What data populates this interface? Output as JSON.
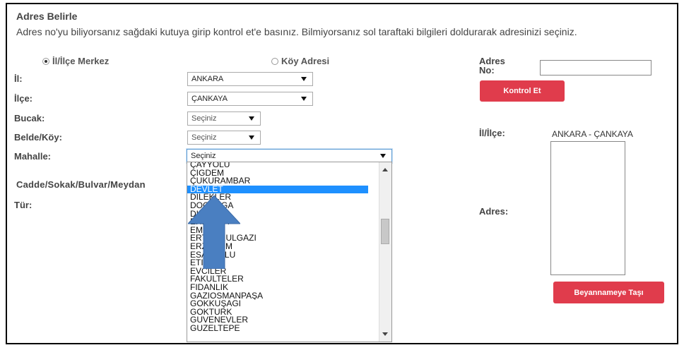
{
  "form": {
    "title": "Adres Belirle",
    "intro": "Adres no'yu biliyorsanız sağdaki kutuya girip kontrol et'e basınız. Bilmiyorsanız sol taraftaki bilgileri doldurarak adresinizi seçiniz.",
    "radio_merkez": "İl/İlçe Merkez",
    "radio_koy": "Köy Adresi",
    "radio_selected": "İl/İlçe Merkez"
  },
  "fields": {
    "il_label": "İl:",
    "il_value": "ANKARA",
    "ilce_label": "İlçe:",
    "ilce_value": "ÇANKAYA",
    "bucak_label": "Bucak:",
    "bucak_value": "Seçiniz",
    "belde_label": "Belde/Köy:",
    "belde_value": "Seçiniz",
    "mahalle_label": "Mahalle:",
    "mahalle_value": "Seçiniz",
    "cadde_label": "Cadde/Sokak/Bulvar/Meydan",
    "tur_label": "Tür:"
  },
  "dropdown": {
    "options": [
      "ÇAYYOLU",
      "ÇİĞDEM",
      "ÇUKURAMBAR",
      "DEVLET",
      "DİLEKLER",
      "DOĞANGA",
      "DİKMEN",
      "EHLİBEYT",
      "EMEK",
      "ERTUĞRULGAZİ",
      "ERZURUM",
      "ESATOĞLU",
      "ETİ",
      "EVCİLER",
      "FAKÜLTELER",
      "FİDANLIK",
      "GAZİOSMANPAŞA",
      "GÖKKUŞAĞI",
      "GÖKTÜRK",
      "GÜVENEVLER",
      "GÜZELTEPE"
    ],
    "selected_index": 3
  },
  "right": {
    "adres_no_label": "Adres No:",
    "kontrol_button": "Kontrol Et",
    "il_ilce_label": "İl/İlçe:",
    "il_ilce_value": "ANKARA - ÇANKAYA",
    "adres_label": "Adres:",
    "beyanname_button": "Beyannameye Taşı"
  },
  "colors": {
    "button_red": "#e03c4c",
    "selection_blue": "#1e90ff",
    "arrow_blue": "#4a7fc1"
  }
}
